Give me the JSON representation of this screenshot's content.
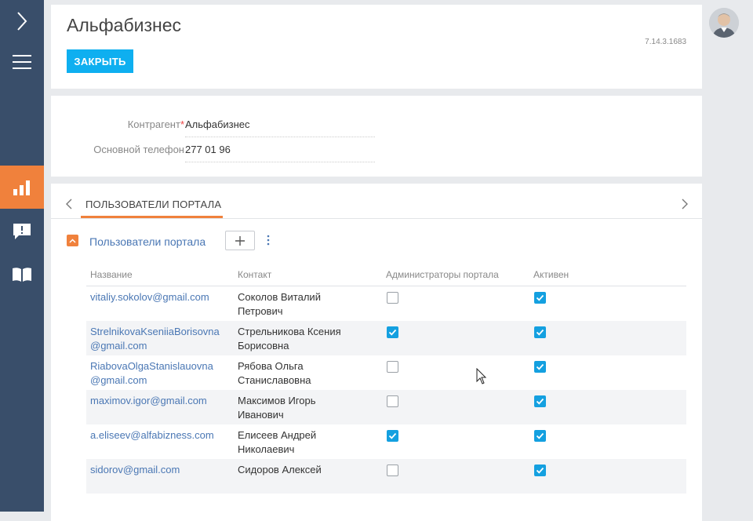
{
  "header": {
    "title": "Альфабизнес",
    "version": "7.14.3.1683",
    "close_label": "ЗАКРЫТЬ"
  },
  "fields": [
    {
      "label": "Контрагент",
      "required": true,
      "value": "Альфабизнес"
    },
    {
      "label": "Основной телефон",
      "required": false,
      "value": "277 01 96"
    }
  ],
  "tabs": {
    "active": "ПОЛЬЗОВАТЕЛИ ПОРТАЛА"
  },
  "detail": {
    "title": "Пользователи портала",
    "columns": [
      "Название",
      "Контакт",
      "Администраторы портала",
      "Активен"
    ],
    "rows": [
      {
        "email": "vitaliy.sokolov@gmail.com",
        "contact": "Соколов Виталий Петрович",
        "admin": false,
        "active": true
      },
      {
        "email": "StrelnikovaKseniiaBorisovna@gmail.com",
        "contact": "Стрельникова Ксения Борисовна",
        "admin": true,
        "active": true
      },
      {
        "email": "RiabovaOlgaStanislauovna@gmail.com",
        "contact": "Рябова Ольга Станиславовна",
        "admin": false,
        "active": true
      },
      {
        "email": "maximov.igor@gmail.com",
        "contact": "Максимов Игорь Иванович",
        "admin": false,
        "active": true
      },
      {
        "email": "a.eliseev@alfabizness.com",
        "contact": "Елисеев Андрей Николаевич",
        "admin": true,
        "active": true
      },
      {
        "email": "sidorov@gmail.com",
        "contact": "Сидоров Алексей",
        "admin": false,
        "active": true
      }
    ]
  },
  "colors": {
    "sidebar": "#394e6a",
    "accent": "#f0813c",
    "primary_button": "#0eaff0",
    "link": "#4a77b4",
    "checkbox": "#14a0e0"
  },
  "icons": {
    "sidebar": [
      "chevron-right-icon",
      "hamburger-menu-icon",
      "dashboard-icon",
      "feed-icon",
      "knowledge-base-icon"
    ]
  }
}
